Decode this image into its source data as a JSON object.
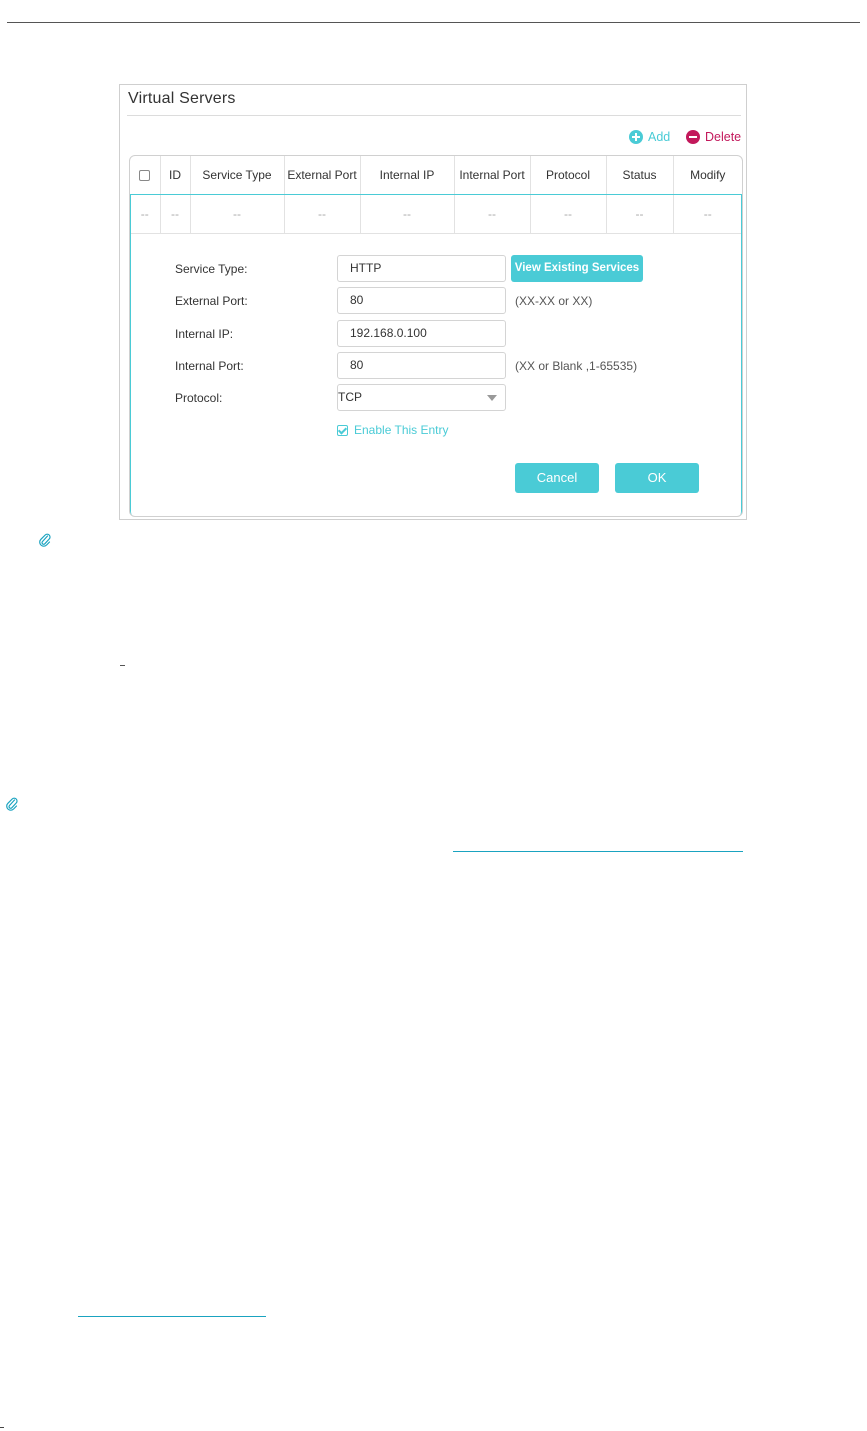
{
  "panel": {
    "title": "Virtual Servers",
    "add_label": "Add",
    "delete_label": "Delete"
  },
  "table": {
    "columns": [
      "ID",
      "Service Type",
      "External Port",
      "Internal IP",
      "Internal Port",
      "Protocol",
      "Status",
      "Modify"
    ],
    "empty_row": [
      "--",
      "--",
      "--",
      "--",
      "--",
      "--",
      "--",
      "--",
      "--"
    ]
  },
  "form": {
    "service_type_label": "Service Type:",
    "service_type_value": "HTTP",
    "view_services_label": "View Existing Services",
    "external_port_label": "External Port:",
    "external_port_value": "80",
    "external_port_hint": "(XX-XX or XX)",
    "internal_ip_label": "Internal IP:",
    "internal_ip_value": "192.168.0.100",
    "internal_port_label": "Internal Port:",
    "internal_port_value": "80",
    "internal_port_hint": "(XX or Blank ,1-65535)",
    "protocol_label": "Protocol:",
    "protocol_value": "TCP",
    "enable_label": "Enable This Entry",
    "cancel_label": "Cancel",
    "ok_label": "OK"
  },
  "colors": {
    "accent": "#4acbd6",
    "delete": "#c2185b"
  }
}
